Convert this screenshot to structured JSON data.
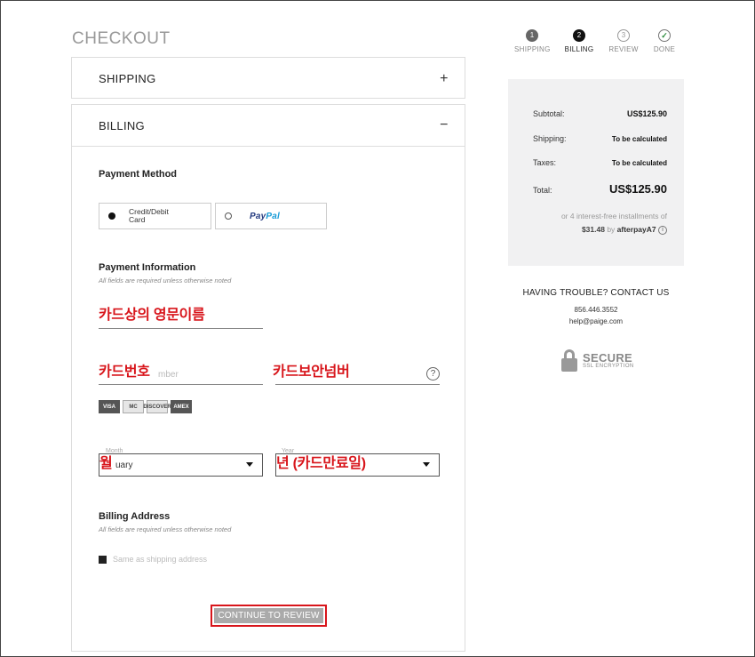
{
  "checkout_title": "CHECKOUT",
  "shipping_section": {
    "label": "SHIPPING",
    "toggle": "+"
  },
  "billing_section": {
    "label": "BILLING",
    "toggle": "−"
  },
  "payment_method": {
    "title": "Payment Method",
    "options": [
      {
        "label": "Credit/Debit Card",
        "line1": "Credit/Debit",
        "line2": "Card",
        "selected": true
      },
      {
        "label": "PayPal",
        "logo_part1": "Pay",
        "logo_part2": "Pal",
        "selected": false
      }
    ]
  },
  "payment_information": {
    "title": "Payment Information",
    "note": "All fields are required unless otherwise noted",
    "name_on_card_annotation": "카드상의 영문이름",
    "card_number_annotation": "카드번호",
    "card_number_ghost": "mber",
    "security_code_annotation": "카드보안넘버",
    "help_symbol": "?",
    "card_logos": [
      "VISA",
      "MC",
      "DISCOVER",
      "AMEX"
    ],
    "month_label": "Month",
    "month_value": "uary",
    "month_annotation": "월",
    "year_label": "Year",
    "year_annotation": "년 (카드만료일)"
  },
  "billing_address": {
    "title": "Billing Address",
    "note": "All fields are required unless otherwise noted",
    "same_as_shipping": "Same as shipping address"
  },
  "continue_button": "CONTINUE TO REVIEW",
  "steps": [
    {
      "number": "1",
      "label": "SHIPPING",
      "state": "complete"
    },
    {
      "number": "2",
      "label": "BILLING",
      "state": "active"
    },
    {
      "number": "3",
      "label": "REVIEW",
      "state": "pending"
    },
    {
      "number": "✓",
      "label": "DONE",
      "state": "done"
    }
  ],
  "summary": {
    "subtotal_label": "Subtotal:",
    "subtotal_value": "US$125.90",
    "shipping_label": "Shipping:",
    "shipping_value": "To be calculated",
    "taxes_label": "Taxes:",
    "taxes_value": "To be calculated",
    "total_label": "Total:",
    "total_value": "US$125.90",
    "afterpay_line1": "or 4 interest-free installments of",
    "afterpay_amount": "$31.48",
    "afterpay_by": "by",
    "afterpay_logo": "afterpay",
    "afterpay_mark": "A7",
    "info_symbol": "i"
  },
  "help": {
    "title": "HAVING TROUBLE? CONTACT US",
    "phone": "856.446.3552",
    "email": "help@paige.com"
  },
  "secure_badge": {
    "title": "SECURE",
    "subtitle": "SSL ENCRYPTION"
  },
  "colors": {
    "annotation_red": "#d8151b",
    "summary_bg": "#f1f1f2",
    "button_gray": "#aaaaaa"
  }
}
